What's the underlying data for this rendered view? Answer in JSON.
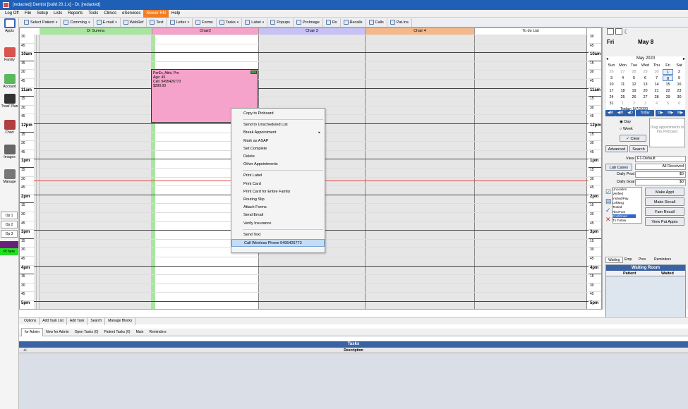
{
  "window": {
    "title": "[redacted] Dentist [build 20.1.x] - Dr. [redacted]"
  },
  "menubar": [
    "Log Off",
    "File",
    "Setup",
    "Lists",
    "Reports",
    "Tools",
    "Clinics",
    "eServices",
    "Newer RN",
    "Help"
  ],
  "toolbar": [
    {
      "label": "Select Patient",
      "caret": true
    },
    {
      "label": "Commlog",
      "caret": true
    },
    {
      "label": "E-mail",
      "caret": true
    },
    {
      "label": "WebRef",
      "caret": false
    },
    {
      "label": "Text",
      "caret": false
    },
    {
      "label": "Letter",
      "caret": true
    },
    {
      "label": "Forms",
      "caret": false
    },
    {
      "label": "Tasks",
      "caret": true
    },
    {
      "label": "Label",
      "caret": true
    },
    {
      "label": "Popups",
      "caret": false
    },
    {
      "label": "ProImage",
      "caret": false
    },
    {
      "label": "Rx",
      "caret": false
    },
    {
      "label": "Recalls",
      "caret": false
    },
    {
      "label": "Calls",
      "caret": false
    },
    {
      "label": "Pat.Ins",
      "caret": false
    }
  ],
  "modules": [
    "Appts",
    "Family",
    "Account",
    "Treat' Plan",
    "Chart",
    "Images",
    "Manage"
  ],
  "op_list": [
    "Op 1",
    "Op 2",
    "Op 3"
  ],
  "status_strip": "Pt here",
  "columns": [
    {
      "name": "Dr Surena",
      "color": "#a8e6a0"
    },
    {
      "name": "Chair2",
      "color": "#f5a3cb"
    },
    {
      "name": "Chair 3",
      "color": "#c6c2f5"
    },
    {
      "name": "Chair 4",
      "color": "#f5b88a"
    },
    {
      "name": "To do List",
      "color": "#ffffff"
    }
  ],
  "times": [
    "30",
    "45",
    "10am",
    "15",
    "30",
    "45",
    "11am",
    "15",
    "30",
    "45",
    "12pm",
    "15",
    "30",
    "45",
    "1pm",
    "15",
    "30",
    "45",
    "2pm",
    "15",
    "30",
    "45",
    "3pm",
    "15",
    "30",
    "45",
    "4pm",
    "15",
    "30",
    "45",
    "5pm"
  ],
  "appointment": {
    "lines": [
      "PerEx, Abhi, Pro",
      "Age: 45",
      "Cell: 9495426773",
      "$290.00"
    ]
  },
  "context_menu": {
    "items": [
      "Copy to Pinboard",
      "Send to Unscheduled List",
      "Break Appointment",
      "Mark as ASAP",
      "Set Complete",
      "Delete",
      "Other Appointments",
      "Print Label",
      "Print Card",
      "Print Card for Entire Family",
      "Routing Slip",
      "Attach Forms",
      "Send Email",
      "Verify Insurance",
      "Send Text",
      "Call Wireless Phone 9495426773"
    ],
    "selected": "Call Wireless Phone 9495426773"
  },
  "date_header": {
    "day": "Fri",
    "date": "May 8"
  },
  "calendar": {
    "month_label": "May 2020",
    "weekdays": [
      "Sun",
      "Mon",
      "Tue",
      "Wed",
      "Thu",
      "Fri",
      "Sat"
    ],
    "weeks": [
      [
        "26",
        "27",
        "28",
        "29",
        "30",
        "1",
        "2"
      ],
      [
        "3",
        "4",
        "5",
        "6",
        "7",
        "8",
        "9"
      ],
      [
        "10",
        "11",
        "12",
        "13",
        "14",
        "15",
        "16"
      ],
      [
        "17",
        "18",
        "19",
        "20",
        "21",
        "22",
        "23"
      ],
      [
        "24",
        "25",
        "26",
        "27",
        "28",
        "29",
        "30"
      ],
      [
        "31",
        "1",
        "2",
        "3",
        "4",
        "5",
        "6"
      ]
    ],
    "today_label": "Today: 5/7/2020"
  },
  "nav": {
    "prev_month": "M",
    "prev_week": "W",
    "prev_day": "D",
    "today": "Today",
    "next_day": "D",
    "next_week": "W",
    "next_month": "M"
  },
  "view_opts": {
    "day": "Day",
    "week": "Week",
    "clear": "Clear",
    "pinboard": "Drag appointments to this Pinboard",
    "advanced": "Advanced",
    "search": "Search"
  },
  "view_select": {
    "label": "View",
    "value": "F1-Default"
  },
  "lab_cases": {
    "button": "Lab Cases",
    "value": "All Received"
  },
  "production": {
    "prod_label": "Daily Prod",
    "prod_value": "$0",
    "goal_label": "Daily Goal",
    "goal_value": "$0"
  },
  "confirm_status": [
    "Unconfirm",
    "Verified",
    "Inshed/Pay",
    "LeftMsg",
    "Texted",
    "Rbc/Fam",
    "Confirmed",
    "Tx Follow"
  ],
  "confirm_selected": "Confirmed",
  "appt_buttons": [
    "Make Appt",
    "Make Recall",
    "Fam Recall",
    "View Pat Appts"
  ],
  "wait_tabs": [
    "Waiting",
    "Emp",
    "Prov",
    "Reminders"
  ],
  "waiting_room": {
    "title": "Waiting Room",
    "col_patient": "Patient",
    "col_waited": "Waited"
  },
  "bottom_bar": [
    "Options",
    "Add Task List",
    "Add Task",
    "Search",
    "Manage Blocks"
  ],
  "task_tabs": [
    "for Admin",
    "New for Admin",
    "Open Tasks (0)",
    "Patient Tasks (0)",
    "Main",
    "Reminders"
  ],
  "tasks": {
    "title": "Tasks",
    "col_description": "Description"
  }
}
